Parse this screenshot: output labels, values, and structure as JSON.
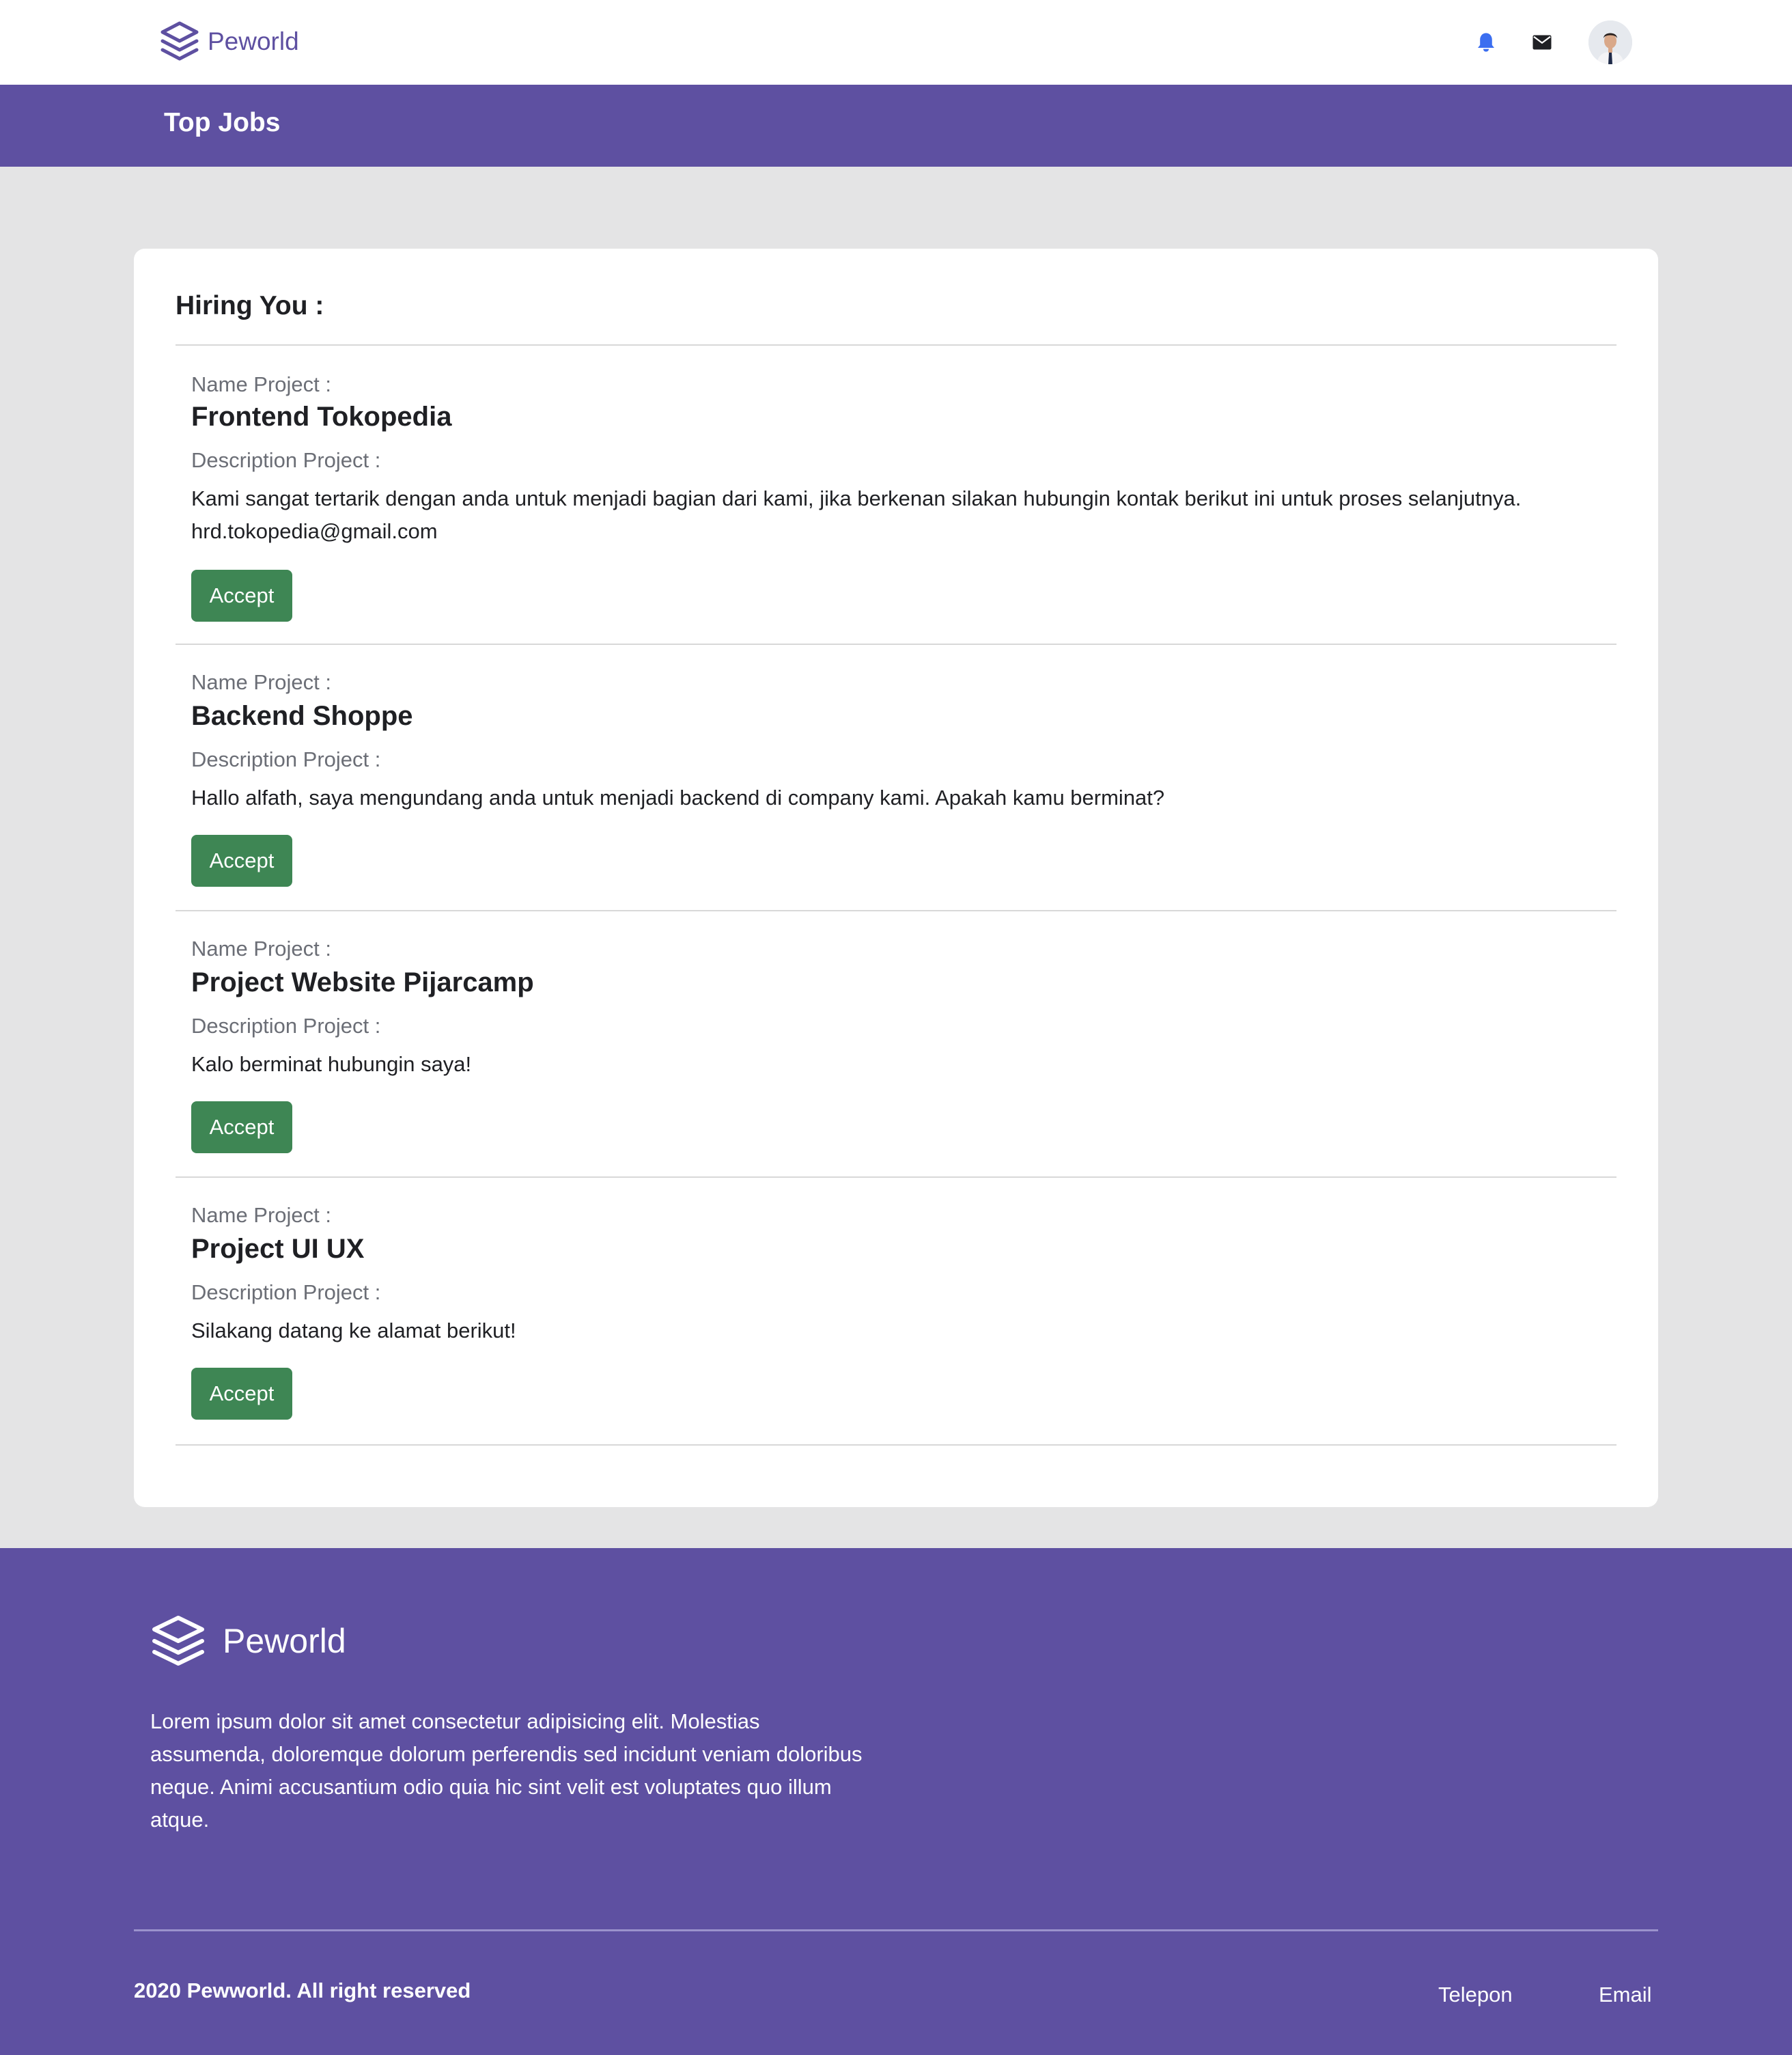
{
  "navbar": {
    "brand": "Peworld",
    "brand_color": "#5e50a1",
    "icons": [
      "bell-icon",
      "mail-icon",
      "user-avatar"
    ],
    "bell_color": "#3b6ef0"
  },
  "banner": {
    "title": "Top Jobs",
    "bg_color": "#5e50a1"
  },
  "card": {
    "title": "Hiring You :",
    "items": [
      {
        "name_label": "Name Project :",
        "name": "Frontend Tokopedia",
        "desc_label": "Description Project :",
        "description": "Kami sangat tertarik dengan anda untuk menjadi bagian dari kami, jika berkenan silakan hubungin kontak berikut ini untuk proses selanjutnya. hrd.tokopedia@gmail.com",
        "button": "Accept"
      },
      {
        "name_label": "Name Project :",
        "name": "Backend Shoppe",
        "desc_label": "Description Project :",
        "description": "Hallo alfath, saya mengundang anda untuk menjadi backend di company kami. Apakah kamu berminat?",
        "button": "Accept"
      },
      {
        "name_label": "Name Project :",
        "name": "Project Website Pijarcamp",
        "desc_label": "Description Project :",
        "description": "Kalo berminat hubungin saya!",
        "button": "Accept"
      },
      {
        "name_label": "Name Project :",
        "name": "Project UI UX",
        "desc_label": "Description Project :",
        "description": "Silakang datang ke alamat berikut!",
        "button": "Accept"
      }
    ],
    "button_color": "#3e8654"
  },
  "footer": {
    "brand": "Peworld",
    "text": "Lorem ipsum dolor sit amet consectetur adipisicing elit. Molestias assumenda, doloremque dolorum perferendis sed incidunt veniam doloribus neque. Animi accusantium odio quia hic sint velit est voluptates quo illum atque.",
    "copyright": "2020 Pewworld. All right reserved",
    "links": [
      "Telepon",
      "Email"
    ],
    "bg_color": "#5e50a1"
  }
}
